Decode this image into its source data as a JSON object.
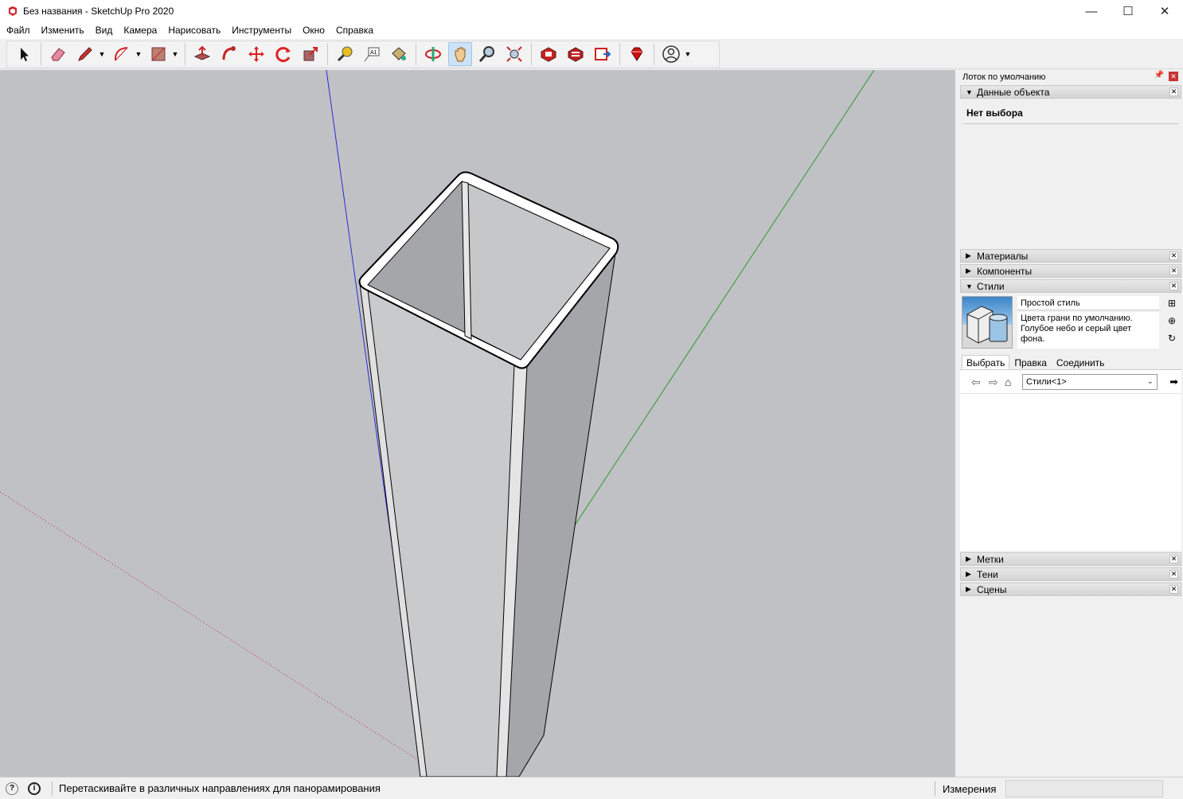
{
  "window": {
    "title": "Без названия - SketchUp Pro 2020",
    "minimize": "—",
    "maximize": "☐",
    "close": "✕"
  },
  "menu": [
    "Файл",
    "Изменить",
    "Вид",
    "Камера",
    "Нарисовать",
    "Инструменты",
    "Окно",
    "Справка"
  ],
  "toolbar": {
    "tools": [
      "select-icon",
      "eraser-icon",
      "pencil-icon",
      "arc-icon",
      "rectangle-icon",
      "push-pull-icon",
      "follow-me-icon",
      "move-icon",
      "rotate-icon",
      "scale-icon",
      "tape-measure-icon",
      "text-icon",
      "paint-bucket-icon",
      "orbit-icon",
      "pan-icon",
      "zoom-icon",
      "zoom-extents-icon",
      "3d-warehouse-icon",
      "extension-warehouse-icon",
      "layout-icon",
      "ruby-icon",
      "account-icon"
    ],
    "active": "pan-icon"
  },
  "tray": {
    "title": "Лоток по умолчанию",
    "entity_info": {
      "label": "Данные объекта",
      "value": "Нет выбора"
    },
    "materials": "Материалы",
    "components": "Компоненты",
    "styles": {
      "label": "Стили",
      "style_name": "Простой стиль",
      "style_description": "Цвета грани по умолчанию. Голубое небо и серый цвет фона.",
      "tabs": [
        "Выбрать",
        "Правка",
        "Соединить"
      ],
      "collection": "Стили<1>"
    },
    "tags": "Метки",
    "shadows": "Тени",
    "scenes": "Сцены"
  },
  "status": {
    "hint": "Перетаскивайте в различных направлениях для панорамирования",
    "measurements_label": "Измерения",
    "measurements_value": ""
  },
  "colors": {
    "viewport_bg": "#c0c1c5",
    "axis_red": "#c22020",
    "axis_green": "#2a9a2a",
    "axis_blue": "#2a2ad0"
  }
}
